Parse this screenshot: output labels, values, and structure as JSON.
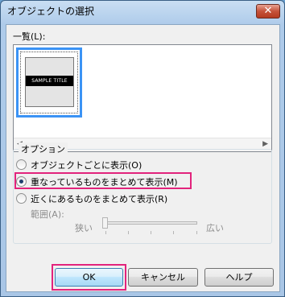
{
  "window": {
    "title": "オブジェクトの選択",
    "close_glyph": "✕"
  },
  "list": {
    "label": "一覧(L):",
    "items": [
      {
        "thumbnail_text": "SAMPLE TITLE"
      }
    ],
    "scroll_left_glyph": "◀",
    "scroll_right_glyph": "▶"
  },
  "options": {
    "group_label": "オプション",
    "radios": [
      {
        "label": "オブジェクトごとに表示(O)",
        "checked": false
      },
      {
        "label": "重なっているものをまとめて表示(M)",
        "checked": true
      },
      {
        "label": "近くにあるものをまとめて表示(R)",
        "checked": false
      }
    ],
    "range": {
      "label": "範囲(A):",
      "min_label": "狭い",
      "max_label": "広い",
      "value": 0
    }
  },
  "buttons": {
    "ok": "OK",
    "cancel": "キャンセル",
    "help": "ヘルプ"
  },
  "colors": {
    "highlight": "#e2237c",
    "selection": "#3b93f5"
  }
}
